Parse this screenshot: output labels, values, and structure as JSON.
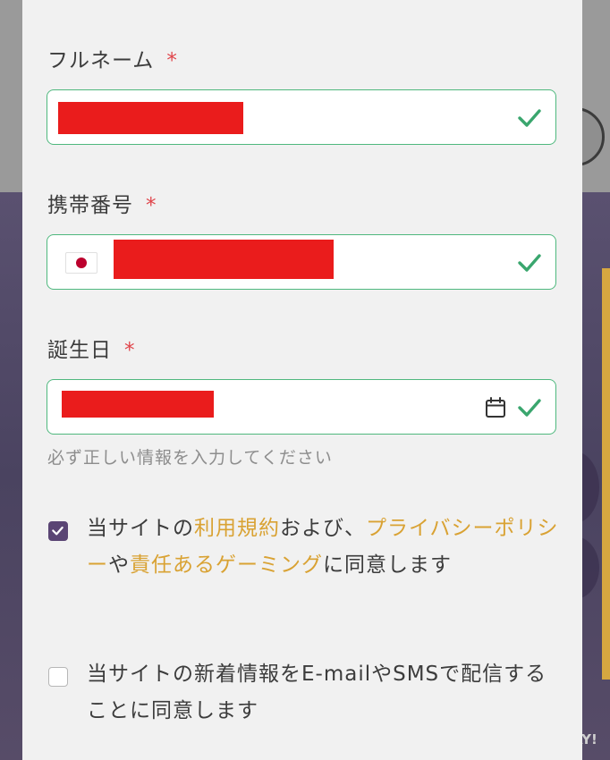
{
  "form": {
    "full_name": {
      "label": "フルネーム",
      "required_mark": "*"
    },
    "phone": {
      "label": "携帯番号",
      "required_mark": "*",
      "country_flag": "japan-flag"
    },
    "birthday": {
      "label": "誕生日",
      "required_mark": "*"
    },
    "helper_text": "必ず正しい情報を入力してください"
  },
  "consents": {
    "terms": {
      "checked": true,
      "text_1": "当サイトの",
      "link_terms": "利用規約",
      "text_2": "および、",
      "link_privacy": "プライバシーポリシー",
      "text_3": "や",
      "link_responsible": "責任あるゲーミング",
      "text_4": "に同意します"
    },
    "newsletter": {
      "checked": false,
      "text": "当サイトの新着情報をE-mailやSMSで配信することに同意します"
    }
  },
  "background": {
    "corner_text": "AY!"
  },
  "colors": {
    "valid_border": "#4fb87e",
    "check_green": "#3aa66e",
    "required_red": "#e0454b",
    "link_gold": "#d9a233",
    "checkbox_purple": "#5a4574",
    "redaction": "#ea1c1c"
  },
  "icons": {
    "valid": "check-icon",
    "date_picker": "calendar-icon"
  }
}
